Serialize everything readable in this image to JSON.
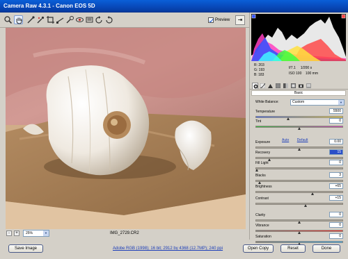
{
  "window": {
    "title": "Camera Raw 4.3.1  -  Canon EOS 5D"
  },
  "toolbar": {
    "tools": [
      "zoom-icon",
      "hand-icon",
      "white-balance-icon",
      "color-sampler-icon",
      "crop-icon",
      "straighten-icon",
      "spot-removal-icon",
      "red-eye-icon",
      "preferences-icon",
      "rotate-ccw-icon",
      "rotate-cw-icon"
    ],
    "preview_label": "Preview",
    "preview_checked": true
  },
  "status": {
    "zoom_minus": "-",
    "zoom_plus": "+",
    "zoom_value": "25%",
    "filename": "IMG_2729.CR2"
  },
  "readout": {
    "r_label": "R:",
    "r_val": "203",
    "g_label": "G:",
    "g_val": "193",
    "b_label": "B:",
    "b_val": "183",
    "aperture": "f/7.1",
    "shutter": "1/200 s",
    "iso": "ISO 100",
    "focal": "100 mm"
  },
  "panel": {
    "section_title": "Basic",
    "wb_label": "White Balance:",
    "wb_value": "Custom",
    "auto_label": "Auto",
    "default_label": "Default",
    "sliders": [
      {
        "label": "Temperature",
        "value": "5500",
        "pos": 0.37
      },
      {
        "label": "Tint",
        "value": "0",
        "pos": 0.5
      },
      {
        "label": "Exposure",
        "value": "0.00",
        "pos": 0.5
      },
      {
        "label": "Recovery",
        "value": "15",
        "pos": 0.15
      },
      {
        "label": "Fill Light",
        "value": "0",
        "pos": 0.0
      },
      {
        "label": "Blacks",
        "value": "3",
        "pos": 0.03
      },
      {
        "label": "Brightness",
        "value": "+65",
        "pos": 0.66
      },
      {
        "label": "Contrast",
        "value": "+15",
        "pos": 0.58
      },
      {
        "label": "Clarity",
        "value": "0",
        "pos": 0.5
      },
      {
        "label": "Vibrance",
        "value": "0",
        "pos": 0.5
      },
      {
        "label": "Saturation",
        "value": "0",
        "pos": 0.5
      }
    ]
  },
  "bottom": {
    "save_label": "Save Image",
    "workflow_text": "Adobe RGB (1998); 16 bit; 2912 by 4368 (12.7MP); 240 ppi",
    "open_label": "Open Copy",
    "reset_label": "Reset",
    "done_label": "Done"
  }
}
